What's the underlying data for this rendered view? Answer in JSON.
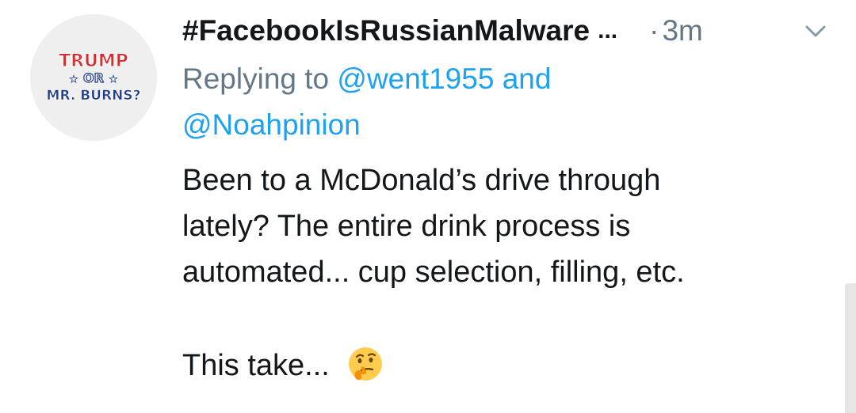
{
  "tweet": {
    "author": {
      "display_name": "#FacebookIsRussianMalware",
      "name_overflow": "...",
      "avatar": {
        "line1": "TRUMP",
        "line2": "OR",
        "line3": "MR. BURNS?"
      }
    },
    "separator": "·",
    "timestamp": "3m",
    "reply_context": {
      "prefix": "Replying to",
      "mention1": "@went1955",
      "conjunction": "and",
      "mention2": "@Noahpinion"
    },
    "body": {
      "line1": "Been to a McDonald’s drive through",
      "line2": "lately? The entire drink process is",
      "line3": "automated... cup selection, filling, etc.",
      "line4": "This take..."
    },
    "icons": {
      "menu": "chevron-down-icon",
      "emoji": "thinking-face-emoji"
    }
  },
  "colors": {
    "name_text": "#14171a",
    "muted_text": "#657786",
    "link": "#1da1f2",
    "avatar_red": "#d32f2f",
    "avatar_blue": "#1e3a8a"
  }
}
